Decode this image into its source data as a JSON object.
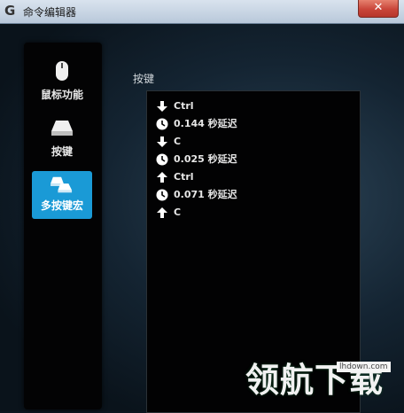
{
  "window": {
    "title": "命令编辑器",
    "close_symbol": "✕"
  },
  "sidebar": {
    "items": [
      {
        "label": "鼠标功能",
        "icon": "mouse-icon",
        "active": false
      },
      {
        "label": "按键",
        "icon": "key-icon",
        "active": false
      },
      {
        "label": "多按键宏",
        "icon": "multi-key-icon",
        "active": true
      }
    ]
  },
  "main": {
    "section_label": "按键",
    "events": [
      {
        "icon": "arrow-down-icon",
        "text": "Ctrl"
      },
      {
        "icon": "clock-icon",
        "text": "0.144 秒延迟"
      },
      {
        "icon": "arrow-down-icon",
        "text": "C"
      },
      {
        "icon": "clock-icon",
        "text": "0.025 秒延迟"
      },
      {
        "icon": "arrow-up-icon",
        "text": "Ctrl"
      },
      {
        "icon": "clock-icon",
        "text": "0.071 秒延迟"
      },
      {
        "icon": "arrow-up-icon",
        "text": "C"
      }
    ]
  },
  "watermark": {
    "text": "领航下载",
    "url": "lhdown.com"
  },
  "colors": {
    "accent": "#1a9ad6",
    "titlebar": "#c8d5e4",
    "close": "#c9463a"
  }
}
